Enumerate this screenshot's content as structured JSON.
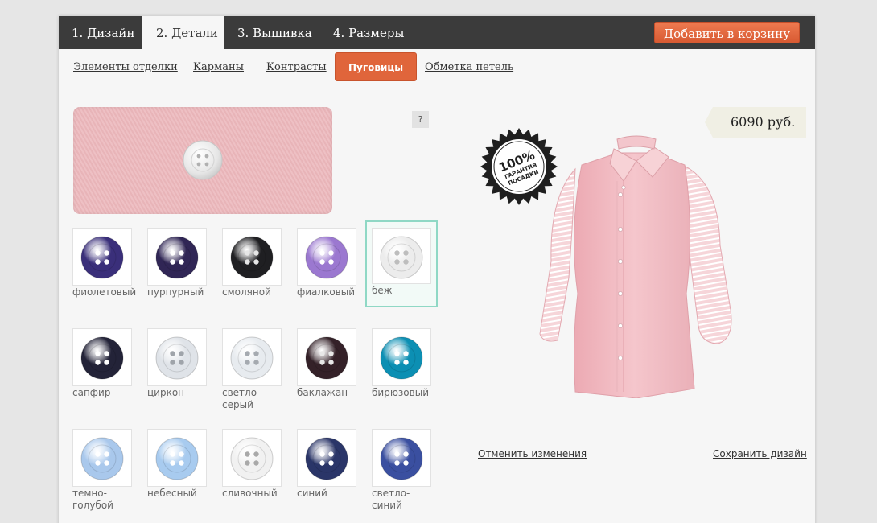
{
  "main_tabs": [
    {
      "label": "1. Дизайн"
    },
    {
      "label": "2. Детали"
    },
    {
      "label": "3. Вышивка"
    },
    {
      "label": "4. Размеры"
    }
  ],
  "cart_button": "Добавить в корзину",
  "sub_tabs": [
    {
      "label": "Элементы отделки"
    },
    {
      "label": "Карманы"
    },
    {
      "label": "Контрасты"
    },
    {
      "label": "Пуговицы"
    },
    {
      "label": "Обметка петель"
    }
  ],
  "help_label": "?",
  "buttons": [
    {
      "name": "фиолетовый",
      "color": "#3a2f7a",
      "holes": "#ffffff"
    },
    {
      "name": "пурпурный",
      "color": "#302655",
      "holes": "#ffffff"
    },
    {
      "name": "смоляной",
      "color": "#1f1f22",
      "holes": "#e6e6e6"
    },
    {
      "name": "фиалковый",
      "color": "#9b78d0",
      "holes": "#ffffff"
    },
    {
      "name": "беж",
      "color": "#ececec",
      "holes": "#bdbdbd"
    },
    {
      "name": "сапфир",
      "color": "#232338",
      "holes": "#ffffff"
    },
    {
      "name": "циркон",
      "color": "#dfe3e8",
      "holes": "#9fa4aa"
    },
    {
      "name": "светло-серый",
      "color": "#e7ebef",
      "holes": "#a5aab0"
    },
    {
      "name": "баклажан",
      "color": "#342128",
      "holes": "#e8e8e8"
    },
    {
      "name": "бирюзовый",
      "color": "#0c8fb3",
      "holes": "#ffffff"
    },
    {
      "name": "темно-голубой",
      "color": "#a9c8ec",
      "holes": "#ffffff"
    },
    {
      "name": "небесный",
      "color": "#a8cbef",
      "holes": "#ffffff"
    },
    {
      "name": "сливочный",
      "color": "#f1f1f1",
      "holes": "#a9a9a9"
    },
    {
      "name": "синий",
      "color": "#2a3568",
      "holes": "#ffffff"
    },
    {
      "name": "светло-синий",
      "color": "#3a4fa0",
      "holes": "#ffffff"
    }
  ],
  "selected_button": "беж",
  "badge": {
    "line1": "100%",
    "line2": "ГАРАНТИЯ",
    "line3": "ПОСАДКИ"
  },
  "price": "6090 руб.",
  "cancel_link": "Отменить изменения",
  "save_link": "Сохранить дизайн",
  "colors": {
    "accent": "#e0653b",
    "topbar": "#3b3b3b",
    "shirt": "#f3c6cc"
  }
}
